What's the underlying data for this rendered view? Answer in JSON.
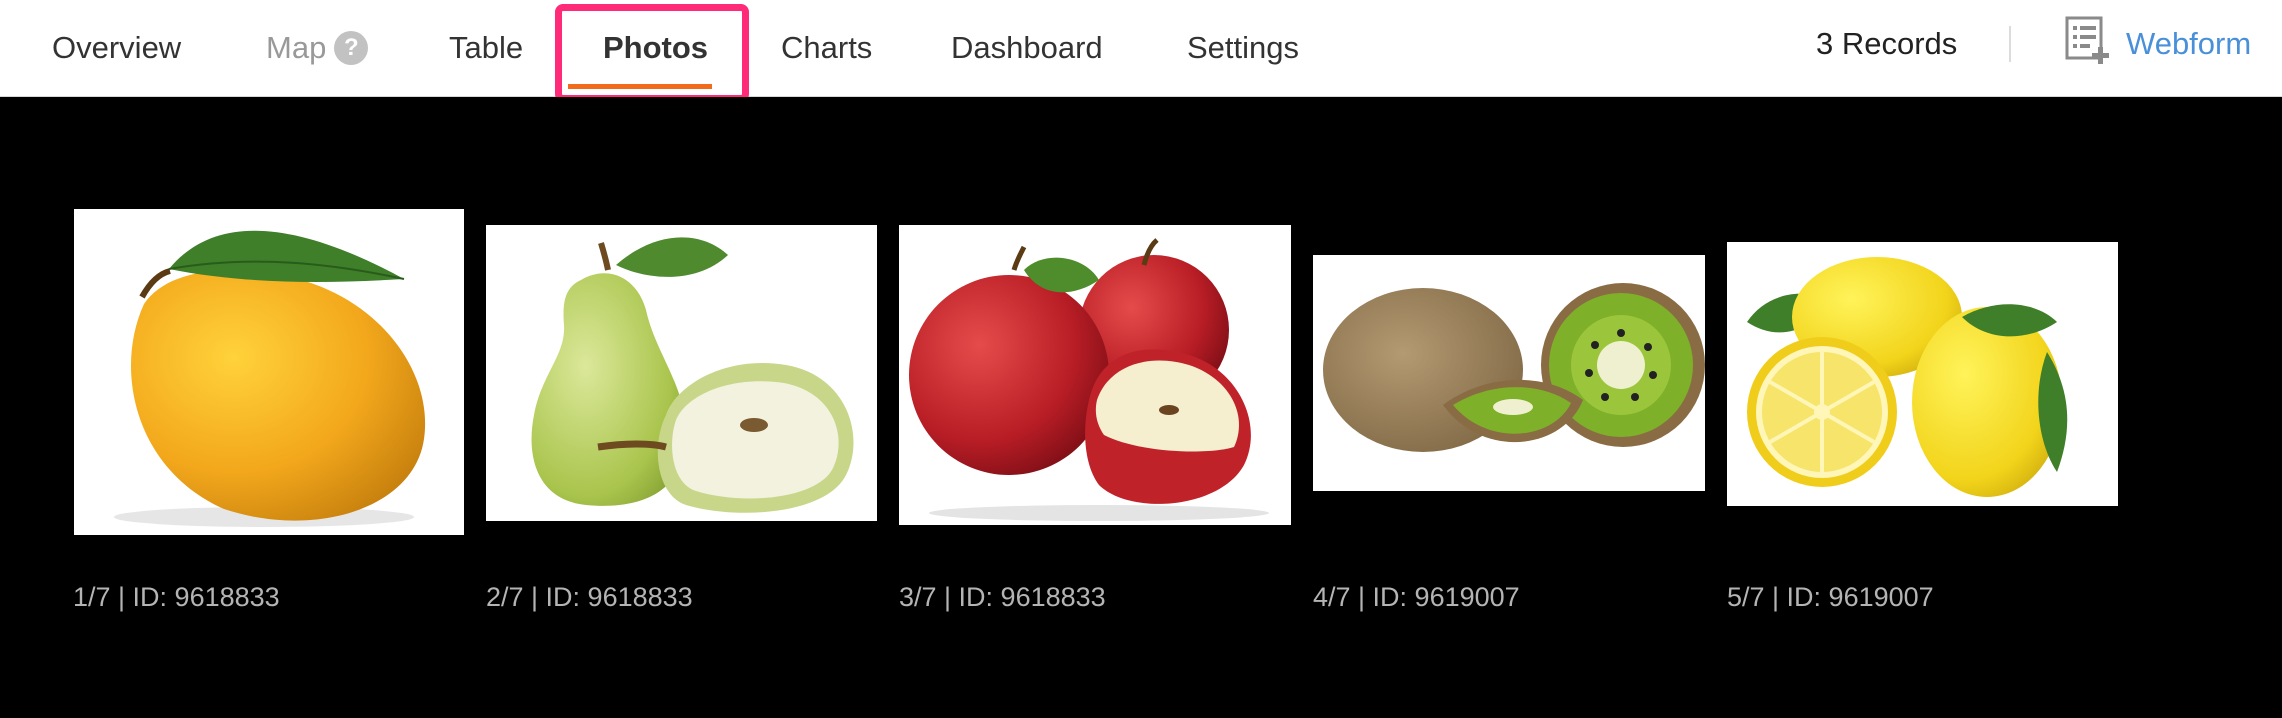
{
  "nav": {
    "tabs": [
      {
        "label": "Overview"
      },
      {
        "label": "Map",
        "help": "?"
      },
      {
        "label": "Table"
      },
      {
        "label": "Photos"
      },
      {
        "label": "Charts"
      },
      {
        "label": "Dashboard"
      },
      {
        "label": "Settings"
      }
    ],
    "active_tab": "Photos",
    "records": "3 Records",
    "webform": "Webform",
    "colors": {
      "active_underline": "#f26a1b",
      "highlight_border": "#ff2a78",
      "link": "#4a90d9"
    }
  },
  "photos": [
    {
      "caption": "1/7 | ID: 9618833",
      "subject": "mango"
    },
    {
      "caption": "2/7 | ID: 9618833",
      "subject": "pear"
    },
    {
      "caption": "3/7 | ID: 9618833",
      "subject": "apples"
    },
    {
      "caption": "4/7 | ID: 9619007",
      "subject": "kiwi"
    },
    {
      "caption": "5/7 | ID: 9619007",
      "subject": "lemons"
    }
  ]
}
